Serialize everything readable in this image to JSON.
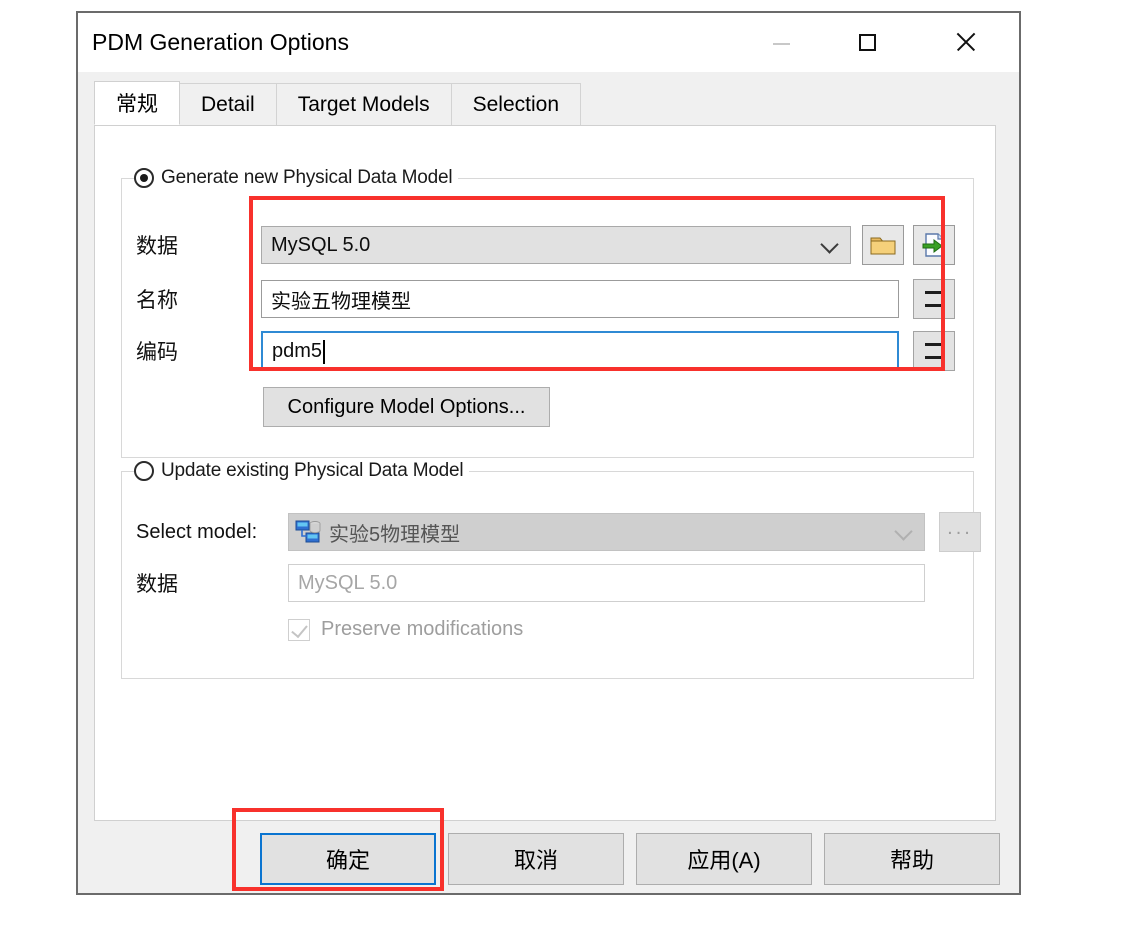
{
  "window": {
    "title": "PDM Generation Options",
    "controls": {
      "minimize": "minimize-icon",
      "maximize": "maximize-icon",
      "close": "close-icon"
    }
  },
  "tabs": [
    {
      "label": "常规",
      "active": true
    },
    {
      "label": "Detail",
      "active": false
    },
    {
      "label": "Target Models",
      "active": false
    },
    {
      "label": "Selection",
      "active": false
    }
  ],
  "generate_group": {
    "radio_label": "Generate new Physical Data Model",
    "selected": true,
    "rows": [
      {
        "label": "数据",
        "value": "MySQL 5.0",
        "control": "combobox",
        "buttons": [
          "folder-icon",
          "export-model-icon"
        ]
      },
      {
        "label": "名称",
        "value": "实验五物理模型",
        "control": "textbox",
        "side_button": "="
      },
      {
        "label": "编码",
        "value": "pdm5",
        "control": "textbox",
        "focused": true,
        "side_button": "="
      }
    ],
    "configure_button": "Configure Model Options..."
  },
  "update_group": {
    "radio_label": "Update existing Physical Data Model",
    "selected": false,
    "select_model_label": "Select model:",
    "select_model_value": "实验5物理模型",
    "select_model_icon": "pdm-model-icon",
    "browse_button": "...",
    "dbms_label": "数据",
    "dbms_value": "MySQL 5.0",
    "preserve_label": "Preserve modifications",
    "preserve_checked": true,
    "preserve_enabled": false
  },
  "footer": {
    "buttons": [
      {
        "label": "确定",
        "default": true
      },
      {
        "label": "取消",
        "default": false
      },
      {
        "label": "应用(A)",
        "default": false
      },
      {
        "label": "帮助",
        "default": false
      }
    ]
  },
  "annotations": {
    "highlight_color": "#f8312c",
    "boxes": [
      "fields-highlight",
      "ok-button-highlight"
    ]
  }
}
